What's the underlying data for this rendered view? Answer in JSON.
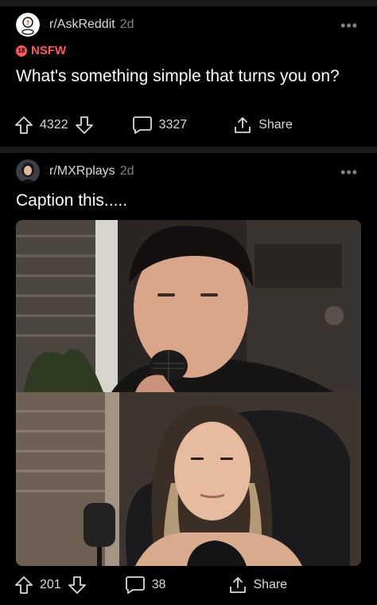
{
  "posts": [
    {
      "subreddit": "r/AskReddit",
      "age": "2d",
      "nsfw_label": "NSFW",
      "nsfw_badge": "18",
      "title": "What's something simple that turns you on?",
      "upvotes": "4322",
      "comments": "3327",
      "share_label": "Share"
    },
    {
      "subreddit": "r/MXRplays",
      "age": "2d",
      "title": "Caption this.....",
      "upvotes": "201",
      "comments": "38",
      "share_label": "Share"
    }
  ],
  "more_glyph": "•••",
  "colors": {
    "nsfw": "#ff585b",
    "background": "#000000",
    "divider": "#1a1a1b",
    "text": "#d7dadc"
  }
}
